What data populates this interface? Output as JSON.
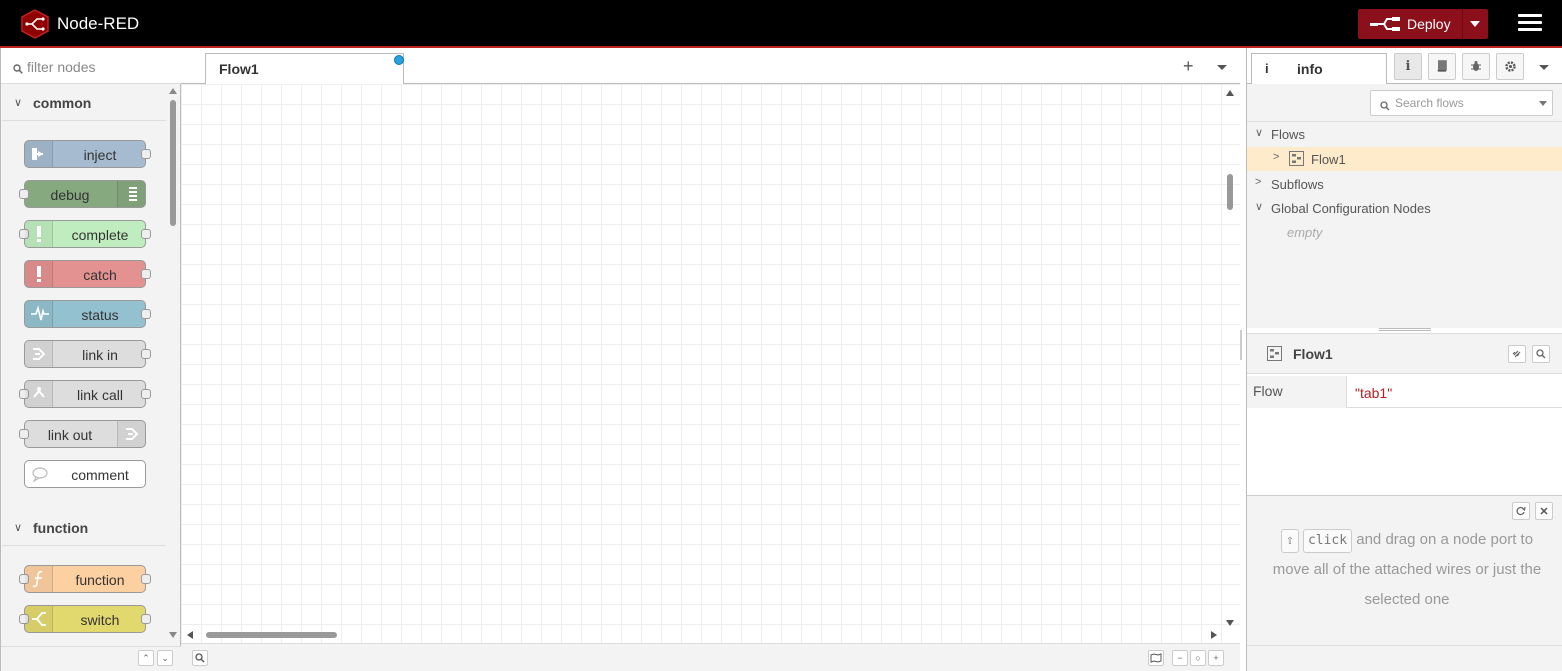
{
  "header": {
    "app_title": "Node-RED",
    "deploy_label": "Deploy",
    "accent_color": "#8c101c"
  },
  "palette": {
    "filter_placeholder": "filter nodes",
    "categories": [
      {
        "name": "common",
        "nodes": [
          {
            "label": "inject",
            "color": "#a6bbcf"
          },
          {
            "label": "debug",
            "color": "#87a980"
          },
          {
            "label": "complete",
            "color": "#c0edc0"
          },
          {
            "label": "catch",
            "color": "#e49191"
          },
          {
            "label": "status",
            "color": "#94c1d0"
          },
          {
            "label": "link in",
            "color": "#dddddd"
          },
          {
            "label": "link call",
            "color": "#dddddd"
          },
          {
            "label": "link out",
            "color": "#dddddd"
          },
          {
            "label": "comment",
            "color": "#ffffff"
          }
        ]
      },
      {
        "name": "function",
        "nodes": [
          {
            "label": "function",
            "color": "#fdd0a2"
          },
          {
            "label": "switch",
            "color": "#e2d96e"
          }
        ]
      }
    ]
  },
  "workspace": {
    "tabs": [
      {
        "label": "Flow1",
        "changed": true
      }
    ]
  },
  "sidebar": {
    "active_tab": "info",
    "tab_icon_glyph": "i",
    "search_placeholder": "Search flows",
    "tree": {
      "flows_label": "Flows",
      "flow_item": "Flow1",
      "subflows_label": "Subflows",
      "global_config_label": "Global Configuration Nodes",
      "empty_label": "empty"
    },
    "info": {
      "title": "Flow1",
      "property_key": "Flow",
      "property_value": "\"tab1\""
    },
    "tip": {
      "key_click": "click",
      "text": "and drag on a node port to move all of the attached wires or just the selected one"
    }
  }
}
